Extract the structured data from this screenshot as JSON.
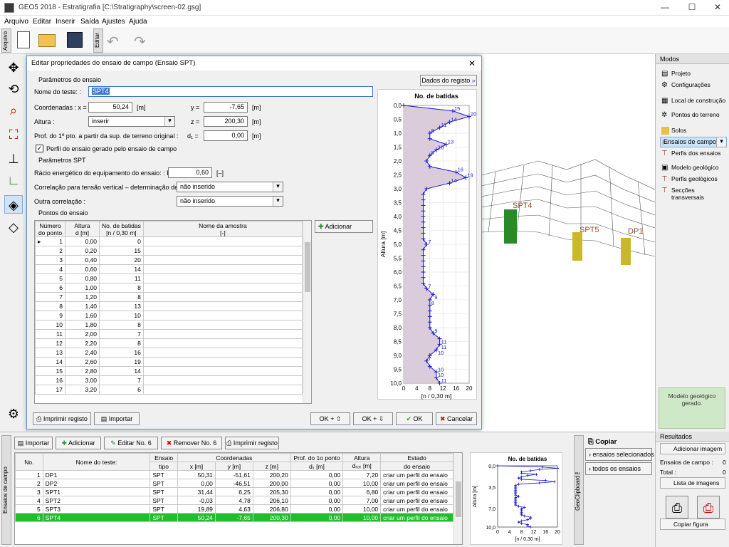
{
  "window": {
    "title": "GEO5 2018 - Estratigrafia [C:\\Stratigraphy\\screen-02.gsg]"
  },
  "menu": [
    "Arquivo",
    "Editar",
    "Inserir",
    "Saída",
    "Ajustes",
    "Ajuda"
  ],
  "toolbar": {
    "left_tab": "Arquivo",
    "right_tab": "Editar"
  },
  "dialog": {
    "title": "Editar propriedades do ensaio de campo (Ensaio SPT)",
    "sec_params": "Parâmetros do ensaio",
    "name_label": "Nome do teste: :",
    "name_value": "SPT4",
    "dados_btn": "Dados do registo",
    "coord_label": "Coordenadas :  x =",
    "x": "50,24",
    "x_unit": "[m]",
    "y_label": "y =",
    "y": "-7,65",
    "y_unit": "[m]",
    "alt_label": "Altura :",
    "alt_value": "inserir",
    "z_label": "z =",
    "z": "200,30",
    "z_unit": "[m]",
    "prof_label": "Prof. do 1º pto. a partir da sup. de terreno original :",
    "d1_label": "d₁ =",
    "d1": "0,00",
    "d1_unit": "[m]",
    "perfil_check": "Perfil do ensaio gerado pelo ensaio de campo",
    "sec_spt": "Parâmetros SPT",
    "er_label": "Rácio energético do equipamento do ensaio: :  Eᵣ =",
    "er": "0,60",
    "er_unit": "[–]",
    "cn_label": "Correlação para tensão vertical – determinação de Cₙ :",
    "cn_value": "não inserido",
    "outra_label": "Outra correlação :",
    "outra_value": "não inserido",
    "sec_points": "Pontos do ensaio",
    "col_headers": [
      [
        "Número",
        "do ponto"
      ],
      [
        "Altura",
        "d [m]"
      ],
      [
        "No. de batidas",
        "[n / 0,30 m]"
      ],
      [
        "Nome da amostra",
        "[-]"
      ]
    ],
    "rows": [
      [
        "1",
        "0,00",
        "0"
      ],
      [
        "2",
        "0,20",
        "15"
      ],
      [
        "3",
        "0,40",
        "20"
      ],
      [
        "4",
        "0,60",
        "14"
      ],
      [
        "5",
        "0,80",
        "11"
      ],
      [
        "6",
        "1,00",
        "8"
      ],
      [
        "7",
        "1,20",
        "8"
      ],
      [
        "8",
        "1,40",
        "13"
      ],
      [
        "9",
        "1,60",
        "10"
      ],
      [
        "10",
        "1,80",
        "8"
      ],
      [
        "11",
        "2,00",
        "7"
      ],
      [
        "12",
        "2,20",
        "8"
      ],
      [
        "13",
        "2,40",
        "16"
      ],
      [
        "14",
        "2,60",
        "19"
      ],
      [
        "15",
        "2,80",
        "14"
      ],
      [
        "16",
        "3,00",
        "7"
      ],
      [
        "17",
        "3,20",
        "6"
      ]
    ],
    "adicionar": "Adicionar",
    "imprimir": "Imprimir registo",
    "importar": "Importar",
    "ok_up": "OK + ⇧",
    "ok_down": "OK + ⇩",
    "ok": "OK",
    "cancelar": "Cancelar"
  },
  "chart_data": {
    "type": "line",
    "title": "No. de batidas",
    "ylabel": "Altura [m]",
    "xlabel": "[n / 0,30 m]",
    "ylim": [
      0,
      10
    ],
    "xlim": [
      0,
      20
    ],
    "yticks": [
      "0,0",
      "0,5",
      "1,0",
      "1,5",
      "2,0",
      "2,5",
      "3,0",
      "3,5",
      "4,0",
      "4,5",
      "5,0",
      "5,5",
      "6,0",
      "6,5",
      "7,0",
      "7,5",
      "8,0",
      "8,5",
      "9,0",
      "9,5",
      "10,0"
    ],
    "xticks": [
      "0",
      "4",
      "8",
      "12",
      "16",
      "20"
    ],
    "depth": [
      0,
      0.2,
      0.4,
      0.6,
      0.8,
      1.0,
      1.2,
      1.4,
      1.6,
      1.8,
      2.0,
      2.2,
      2.4,
      2.6,
      2.8,
      3.0,
      3.2,
      3.4,
      3.6,
      3.8,
      4.0,
      4.2,
      4.4,
      4.6,
      4.8,
      5.0,
      5.2,
      5.4,
      5.6,
      5.8,
      6.0,
      6.2,
      6.4,
      6.6,
      6.8,
      7.0,
      7.2,
      7.4,
      7.6,
      7.8,
      8.0,
      8.2,
      8.4,
      8.6,
      8.8,
      9.0,
      9.2,
      9.4,
      9.6,
      9.8,
      10.0
    ],
    "blows": [
      0,
      15,
      20,
      14,
      11,
      8,
      8,
      13,
      10,
      8,
      7,
      8,
      16,
      19,
      14,
      7,
      6,
      6,
      6,
      6,
      6,
      6,
      6,
      6,
      6,
      7,
      6,
      6,
      6,
      6,
      6,
      6,
      6,
      7,
      9,
      8,
      8,
      8,
      8,
      8,
      8,
      9,
      11,
      11,
      10,
      8,
      7,
      8,
      10,
      10,
      11
    ],
    "labels": [
      [
        "0,2",
        "15"
      ],
      [
        "0,4",
        "20"
      ],
      [
        "0,6",
        "14"
      ],
      [
        "0,8",
        "11"
      ],
      [
        "1,0",
        "8"
      ],
      [
        "1,4",
        "13"
      ],
      [
        "1,6",
        "10"
      ],
      [
        "1,8",
        "8"
      ],
      [
        "2,4",
        "16"
      ],
      [
        "2,6",
        "19"
      ],
      [
        "2,8",
        "14"
      ],
      [
        "5,0",
        "7"
      ],
      [
        "6,6",
        "7"
      ],
      [
        "7,0",
        "9"
      ],
      [
        "7,2",
        "8"
      ],
      [
        "8,2",
        "9"
      ],
      [
        "8,6",
        "11"
      ],
      [
        "8,8",
        "11"
      ],
      [
        "9,0",
        "10"
      ],
      [
        "9,2",
        "7"
      ],
      [
        "9,6",
        "10"
      ],
      [
        "9,8",
        "10"
      ],
      [
        "10,0",
        "11"
      ]
    ]
  },
  "scene": {
    "labels": [
      "SPT4",
      "SPT5",
      "DP1"
    ]
  },
  "right": {
    "modos": "Modos",
    "items": [
      "Projeto",
      "Configurações",
      "Local de construção",
      "Pontos do terreno",
      "Solos",
      "Ensaios de campo",
      "Perfis dos ensaios",
      "Modelo geológico",
      "Perfis geológicos",
      "Secções transversais"
    ],
    "model_msg": "Modelo geológico gerado.",
    "resultados": "Resultados",
    "add_image": "Adicionar imagem",
    "ensaios_label": "Ensaios de campo :",
    "ensaios_val": "0",
    "total_label": "Total :",
    "total_val": "0",
    "lista": "Lista de imagens",
    "copiar_fig": "Copiar figura"
  },
  "bottom": {
    "side_tab": "Ensaios de campo",
    "btn_importar": "Importar",
    "btn_adicionar": "Adicionar",
    "btn_editar": "Editar No. 6",
    "btn_remover": "Remover No. 6",
    "btn_imprimir": "Imprimir registo",
    "headers": {
      "no": "No.",
      "nome": "Nome do teste:",
      "tipo1": "Ensaio",
      "tipo2": "tipo",
      "coords": "Coordenadas",
      "x": "x [m]",
      "y": "y [m]",
      "z": "z [m]",
      "prof1": "Prof. do 1o ponto",
      "prof2": "d₁ [m]",
      "alt1": "Altura",
      "alt2": "dₜₒₜ [m]",
      "est1": "Estado",
      "est2": "do ensaio"
    },
    "rows": [
      [
        "1",
        "DP1",
        "SPT",
        "50,31",
        "-51,61",
        "200,20",
        "0,00",
        "7,20",
        "criar um perfil do ensaio"
      ],
      [
        "2",
        "DP2",
        "SPT",
        "0,00",
        "-46,51",
        "200,00",
        "0,00",
        "10,00",
        "criar um perfil do ensaio"
      ],
      [
        "3",
        "SPT1",
        "SPT",
        "31,44",
        "6,25",
        "205,30",
        "0,00",
        "6,80",
        "criar um perfil do ensaio"
      ],
      [
        "4",
        "SPT2",
        "SPT",
        "-0,03",
        "4,78",
        "206,10",
        "0,00",
        "7,00",
        "criar um perfil do ensaio"
      ],
      [
        "5",
        "SPT3",
        "SPT",
        "19,89",
        "4,63",
        "206,80",
        "0,00",
        "10,00",
        "criar um perfil do ensaio"
      ],
      [
        "6",
        "SPT4",
        "SPT",
        "50,24",
        "-7,65",
        "200,30",
        "0,00",
        "10,00",
        "criar um perfil do ensaio"
      ]
    ],
    "copiar": "Copiar",
    "sel_btn": "ensaios selecionados",
    "todos_btn": "todos os ensaios",
    "geoclip": "GeoClipboard™",
    "mini_title": "No. de batidas",
    "mini_ylabel": "Altura [m]",
    "mini_xlabel": "[n / 0,30 m]",
    "mini_yticks": [
      "0,0",
      "3,5",
      "7,0",
      "10,0"
    ],
    "mini_xticks": [
      "0",
      "4",
      "8",
      "12",
      "16",
      "20"
    ]
  }
}
